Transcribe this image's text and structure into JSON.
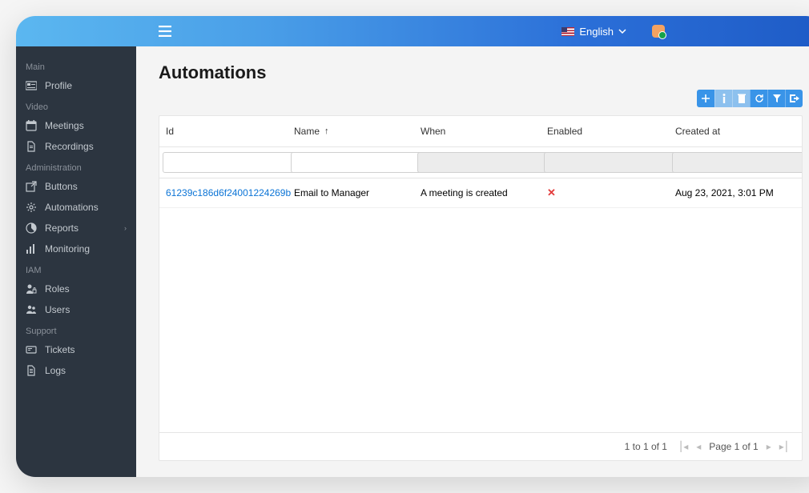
{
  "header": {
    "language_label": "English"
  },
  "sidebar": {
    "sections": [
      {
        "label": "Main",
        "items": [
          {
            "name": "profile",
            "label": "Profile",
            "icon": "card-icon"
          }
        ]
      },
      {
        "label": "Video",
        "items": [
          {
            "name": "meetings",
            "label": "Meetings",
            "icon": "calendar-icon"
          },
          {
            "name": "recordings",
            "label": "Recordings",
            "icon": "file-icon"
          }
        ]
      },
      {
        "label": "Administration",
        "items": [
          {
            "name": "buttons",
            "label": "Buttons",
            "icon": "external-icon"
          },
          {
            "name": "automations",
            "label": "Automations",
            "icon": "gear-icon"
          },
          {
            "name": "reports",
            "label": "Reports",
            "icon": "chart-icon",
            "hasChildren": true
          },
          {
            "name": "monitoring",
            "label": "Monitoring",
            "icon": "bars-icon"
          }
        ]
      },
      {
        "label": "IAM",
        "items": [
          {
            "name": "roles",
            "label": "Roles",
            "icon": "lock-user-icon"
          },
          {
            "name": "users",
            "label": "Users",
            "icon": "users-icon"
          }
        ]
      },
      {
        "label": "Support",
        "items": [
          {
            "name": "tickets",
            "label": "Tickets",
            "icon": "ticket-icon"
          },
          {
            "name": "logs",
            "label": "Logs",
            "icon": "log-icon"
          }
        ]
      }
    ]
  },
  "page": {
    "title": "Automations"
  },
  "table": {
    "columns": {
      "id": "Id",
      "name": "Name",
      "when": "When",
      "enabled": "Enabled",
      "created": "Created at"
    },
    "row": {
      "id": "61239c186d6f24001224269b",
      "name": "Email to Manager",
      "when": "A meeting is created",
      "enabled_false_marker": "✕",
      "created": "Aug 23, 2021, 3:01 PM"
    },
    "footer": {
      "range": "1 to 1 of 1",
      "page_label": "Page 1 of 1"
    }
  }
}
